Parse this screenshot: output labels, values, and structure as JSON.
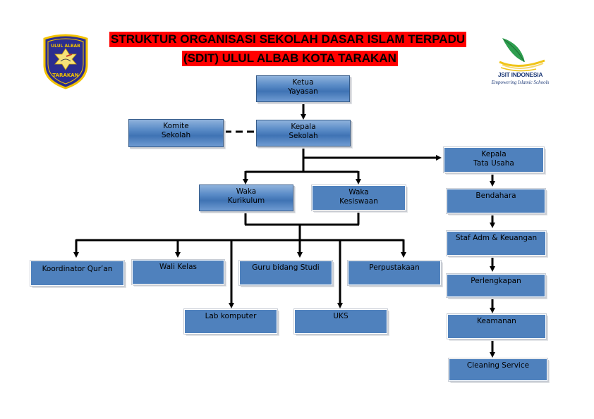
{
  "title": {
    "line1": "STRUKTUR ORGANISASI SEKOLAH DASAR ISLAM TERPADU",
    "line2": "(SDIT) ULUL ALBAB KOTA TARAKAN"
  },
  "logos": {
    "left": {
      "icon": "school-crest-icon",
      "top_text": "ULUL ALBAB",
      "bottom_text": "TARAKAN"
    },
    "right": {
      "icon": "quill-leaf-icon",
      "name": "JSIT INDONESIA",
      "tagline": "Empowering Islamic Schools"
    }
  },
  "colors": {
    "title_bg": "#ff0000",
    "box_fill": "#4f81bd",
    "line": "#000000"
  },
  "nodes": {
    "ketua_yayasan": [
      "Ketua",
      "Yayasan"
    ],
    "komite_sekolah": [
      "Komite",
      "Sekolah"
    ],
    "kepala_sekolah": [
      "Kepala",
      "Sekolah"
    ],
    "kepala_tata_usaha": [
      "Kepala",
      "Tata Usaha"
    ],
    "waka_kurikulum": [
      "Waka",
      "Kurikulum"
    ],
    "waka_kesiswaan": [
      "Waka",
      "Kesiswaan"
    ],
    "koordinator_quran": "Koordinator Qur’an",
    "wali_kelas": "Wali Kelas",
    "guru_bidang_studi": "Guru bidang Studi",
    "perpustakaan": "Perpustakaan",
    "lab_komputer": "Lab komputer",
    "uks": "UKS",
    "bendahara": "Bendahara",
    "staf_adm_keuangan": "Staf Adm & Keuangan",
    "perlengkapan": "Perlengkapan",
    "keamanan": "Keamanan",
    "cleaning_service": "Cleaning Service"
  },
  "edges": [
    {
      "from": "ketua_yayasan",
      "to": "kepala_sekolah",
      "style": "solid-arrow"
    },
    {
      "from": "komite_sekolah",
      "to": "kepala_sekolah",
      "style": "dashed"
    },
    {
      "from": "kepala_sekolah",
      "to": "kepala_tata_usaha",
      "style": "solid-arrow"
    },
    {
      "from": "kepala_sekolah",
      "to": "waka_kurikulum",
      "style": "solid-arrow"
    },
    {
      "from": "kepala_sekolah",
      "to": "waka_kesiswaan",
      "style": "solid-arrow"
    },
    {
      "from": "waka_kurikulum+waka_kesiswaan",
      "to": "koordinator_quran",
      "style": "solid-arrow"
    },
    {
      "from": "waka_kurikulum+waka_kesiswaan",
      "to": "wali_kelas",
      "style": "solid-arrow"
    },
    {
      "from": "waka_kurikulum+waka_kesiswaan",
      "to": "lab_komputer",
      "style": "solid-arrow"
    },
    {
      "from": "waka_kurikulum+waka_kesiswaan",
      "to": "guru_bidang_studi",
      "style": "solid-arrow"
    },
    {
      "from": "waka_kurikulum+waka_kesiswaan",
      "to": "uks",
      "style": "solid-arrow"
    },
    {
      "from": "waka_kurikulum+waka_kesiswaan",
      "to": "perpustakaan",
      "style": "solid-arrow"
    },
    {
      "from": "kepala_tata_usaha",
      "to": "bendahara",
      "style": "solid-arrow"
    },
    {
      "from": "bendahara",
      "to": "staf_adm_keuangan",
      "style": "solid-arrow"
    },
    {
      "from": "staf_adm_keuangan",
      "to": "perlengkapan",
      "style": "solid-arrow"
    },
    {
      "from": "perlengkapan",
      "to": "keamanan",
      "style": "solid-arrow"
    },
    {
      "from": "keamanan",
      "to": "cleaning_service",
      "style": "solid-arrow"
    }
  ]
}
